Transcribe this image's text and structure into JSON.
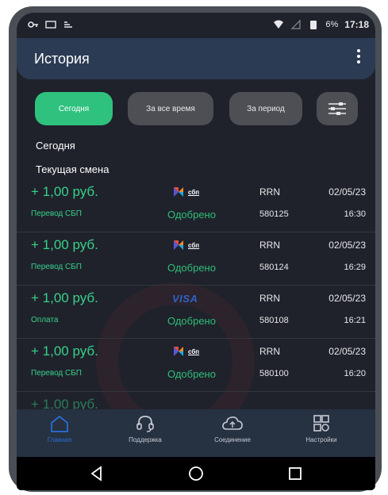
{
  "status_bar": {
    "battery": "6%",
    "time": "17:18"
  },
  "header": {
    "title": "История"
  },
  "filters": {
    "today": "Сегодня",
    "all_time": "За все время",
    "period": "За период"
  },
  "sections": {
    "date_label": "Сегодня",
    "shift_label": "Текущая смена"
  },
  "transactions": [
    {
      "amount": "+ 1,00 руб.",
      "type": "Перевод СБП",
      "status": "Одобрено",
      "rrn_label": "RRN",
      "rrn": "580125",
      "date": "02/05/23",
      "time": "16:30",
      "logo_text": "сбп"
    },
    {
      "amount": "+ 1,00 руб.",
      "type": "Перевод СБП",
      "status": "Одобрено",
      "rrn_label": "RRN",
      "rrn": "580124",
      "date": "02/05/23",
      "time": "16:29",
      "logo_text": "сбп"
    },
    {
      "amount": "+ 1,00 руб.",
      "type": "Оплата",
      "status": "Одобрено",
      "rrn_label": "RRN",
      "rrn": "580108",
      "date": "02/05/23",
      "time": "16:21",
      "logo_text": "VISA"
    },
    {
      "amount": "+ 1,00 руб.",
      "type": "Перевод СБП",
      "status": "Одобрено",
      "rrn_label": "RRN",
      "rrn": "580100",
      "date": "02/05/23",
      "time": "16:20",
      "logo_text": "сбп"
    }
  ],
  "bottom_nav": [
    {
      "label": "Главная",
      "icon": "home-icon"
    },
    {
      "label": "Поддержка",
      "icon": "headset-icon"
    },
    {
      "label": "Соединение",
      "icon": "cloud-icon"
    },
    {
      "label": "Настройки",
      "icon": "grid-settings-icon"
    }
  ],
  "colors": {
    "accent": "#2ec27e",
    "amount": "#37d18a",
    "active_nav": "#2a6fd6"
  }
}
